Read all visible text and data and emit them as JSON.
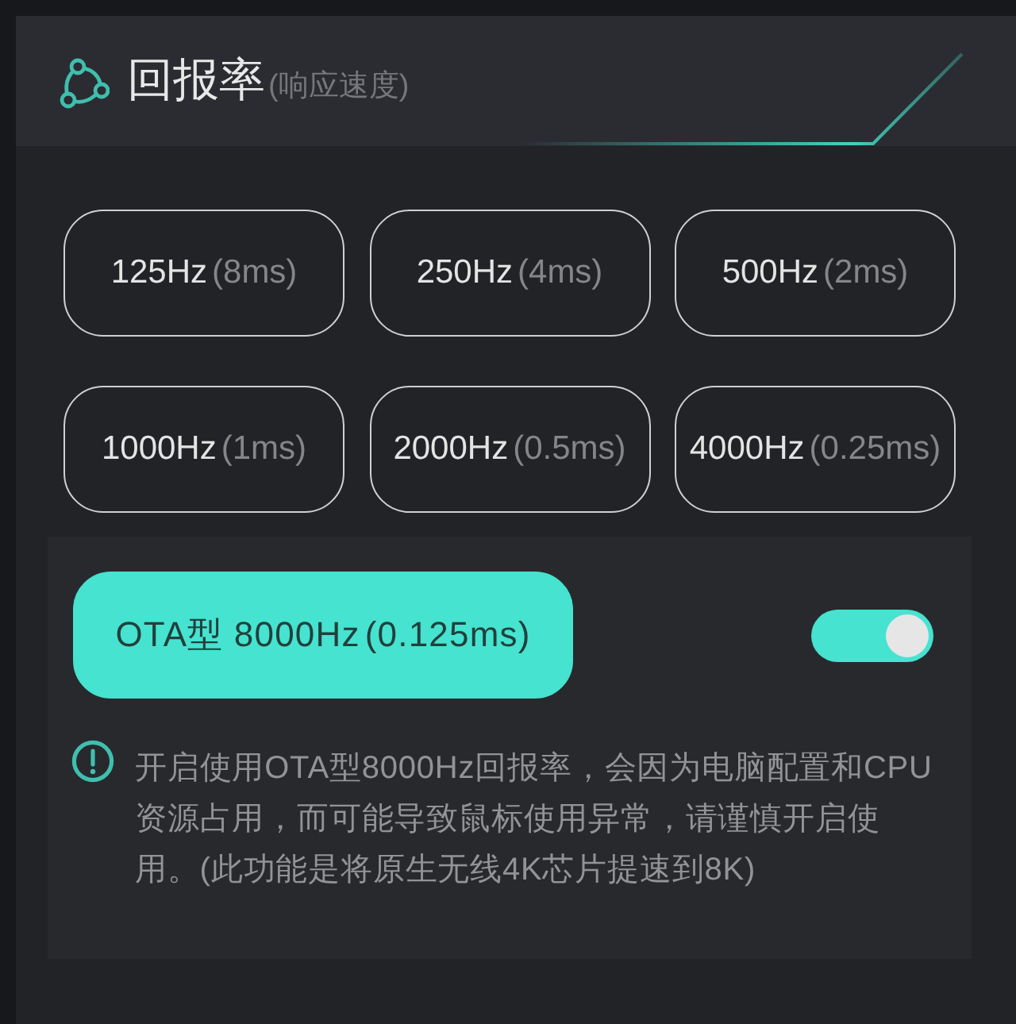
{
  "header": {
    "title": "回报率",
    "subtitle": "(响应速度)"
  },
  "rates": [
    {
      "rate": "125Hz",
      "interval": "(8ms)",
      "selected": false
    },
    {
      "rate": "250Hz",
      "interval": "(4ms)",
      "selected": false
    },
    {
      "rate": "500Hz",
      "interval": "(2ms)",
      "selected": false
    },
    {
      "rate": "1000Hz",
      "interval": "(1ms)",
      "selected": false
    },
    {
      "rate": "2000Hz",
      "interval": "(0.5ms)",
      "selected": false
    },
    {
      "rate": "4000Hz",
      "interval": "(0.25ms)",
      "selected": false
    }
  ],
  "ota": {
    "option": {
      "rate": "OTA型 8000Hz",
      "interval": "(0.125ms)",
      "selected": true
    },
    "toggle": {
      "on": true
    },
    "warning": "开启使用OTA型8000Hz回报率，会因为电脑配置和CPU资源占用，而可能导致鼠标使用异常，请谨慎开启使用。(此功能是将原生无线4K芯片提速到8K)"
  }
}
